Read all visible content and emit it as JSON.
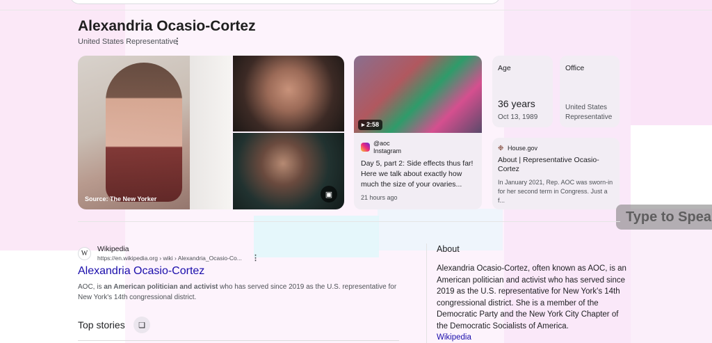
{
  "person": {
    "name": "Alexandria Ocasio-Cortez",
    "subtitle": "United States Representative",
    "more_icon": "vertical-dots-icon"
  },
  "photos": {
    "caption": "Source: The New Yorker",
    "image_icon": "image-icon"
  },
  "video": {
    "duration": "▸ 2:58",
    "handle": "@aoc",
    "source": "Instagram",
    "text": "Day 5, part 2: Side effects thus far! Here we talk about exactly how much the size of your ovaries...",
    "time": "21 hours ago"
  },
  "facts": {
    "age_label": "Age",
    "age_value": "36 years",
    "birth_date": "Oct 13, 1989",
    "office_label": "Office",
    "office_value": "United States Representative"
  },
  "house": {
    "source": "House.gov",
    "title": "About | Representative Ocasio-Cortez",
    "text": "In January 2021, Rep. AOC was sworn-in for her second term in Congress. Just a f..."
  },
  "overlay": {
    "type_to_speak": "Type to Speak"
  },
  "wiki": {
    "logo": "W",
    "name": "Wikipedia",
    "url": "https://en.wikipedia.org › wiki › Alexandria_Ocasio-Co...",
    "link": "Alexandria Ocasio-Cortez",
    "snippet_pre": "AOC, is ",
    "snippet_bold": "an American politician and activist",
    "snippet_post": " who has served since 2019 as the U.S. representative for New York's 14th congressional district."
  },
  "stories": {
    "label": "Top stories"
  },
  "about": {
    "title": "About",
    "text": "Alexandria Ocasio-Cortez, often known as AOC, is an American politician and activist who has served since 2019 as the U.S. representative for New York's 14th congressional district. She is a member of the Democratic Party and the New York City Chapter of the Democratic Socialists of America.",
    "link": "Wikipedia"
  },
  "colors": {
    "link": "#1a0dab",
    "card_bg": "#f2edf4"
  }
}
